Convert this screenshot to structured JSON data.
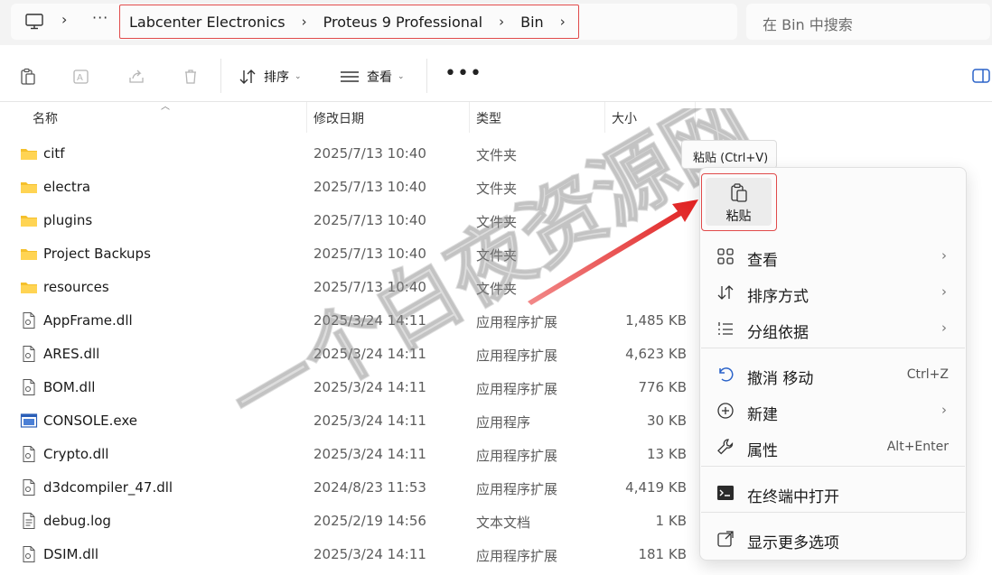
{
  "address": {
    "breadcrumbs": [
      "Labcenter Electronics",
      "Proteus 9 Professional",
      "Bin"
    ],
    "ellipsis": "···"
  },
  "search": {
    "placeholder": "在 Bin 中搜索"
  },
  "toolbar": {
    "sort_label": "排序",
    "view_label": "查看",
    "more_label": "•••"
  },
  "columns": {
    "name": "名称",
    "modified": "修改日期",
    "type": "类型",
    "size": "大小"
  },
  "files": [
    {
      "name": "citf",
      "modified": "2025/7/13 10:40",
      "type": "文件夹",
      "size": "",
      "icon": "folder-icon"
    },
    {
      "name": "electra",
      "modified": "2025/7/13 10:40",
      "type": "文件夹",
      "size": "",
      "icon": "folder-icon"
    },
    {
      "name": "plugins",
      "modified": "2025/7/13 10:40",
      "type": "文件夹",
      "size": "",
      "icon": "folder-icon"
    },
    {
      "name": "Project Backups",
      "modified": "2025/7/13 10:40",
      "type": "文件夹",
      "size": "",
      "icon": "folder-icon"
    },
    {
      "name": "resources",
      "modified": "2025/7/13 10:40",
      "type": "文件夹",
      "size": "",
      "icon": "folder-icon"
    },
    {
      "name": "AppFrame.dll",
      "modified": "2025/3/24 14:11",
      "type": "应用程序扩展",
      "size": "1,485 KB",
      "icon": "file-icon"
    },
    {
      "name": "ARES.dll",
      "modified": "2025/3/24 14:11",
      "type": "应用程序扩展",
      "size": "4,623 KB",
      "icon": "file-icon"
    },
    {
      "name": "BOM.dll",
      "modified": "2025/3/24 14:11",
      "type": "应用程序扩展",
      "size": "776 KB",
      "icon": "file-icon"
    },
    {
      "name": "CONSOLE.exe",
      "modified": "2025/3/24 14:11",
      "type": "应用程序",
      "size": "30 KB",
      "icon": "exe-icon"
    },
    {
      "name": "Crypto.dll",
      "modified": "2025/3/24 14:11",
      "type": "应用程序扩展",
      "size": "13 KB",
      "icon": "file-icon"
    },
    {
      "name": "d3dcompiler_47.dll",
      "modified": "2024/8/23 11:53",
      "type": "应用程序扩展",
      "size": "4,419 KB",
      "icon": "file-icon"
    },
    {
      "name": "debug.log",
      "modified": "2025/2/19 14:56",
      "type": "文本文档",
      "size": "1 KB",
      "icon": "text-file-icon"
    },
    {
      "name": "DSIM.dll",
      "modified": "2025/3/24 14:11",
      "type": "应用程序扩展",
      "size": "181 KB",
      "icon": "file-icon"
    }
  ],
  "context_menu": {
    "tooltip": "粘贴 (Ctrl+V)",
    "paste_label": "粘贴",
    "items": [
      {
        "label": "查看",
        "shortcut": "",
        "submenu": true,
        "icon": "grid-icon"
      },
      {
        "label": "排序方式",
        "shortcut": "",
        "submenu": true,
        "icon": "sort-icon"
      },
      {
        "label": "分组依据",
        "shortcut": "",
        "submenu": true,
        "icon": "group-list-icon"
      },
      {
        "label": "撤消 移动",
        "shortcut": "Ctrl+Z",
        "submenu": false,
        "icon": "undo-icon"
      },
      {
        "label": "新建",
        "shortcut": "",
        "submenu": true,
        "icon": "new-plus-icon"
      },
      {
        "label": "属性",
        "shortcut": "Alt+Enter",
        "submenu": false,
        "icon": "wrench-icon"
      },
      {
        "label": "在终端中打开",
        "shortcut": "",
        "submenu": false,
        "icon": "terminal-icon"
      },
      {
        "label": "显示更多选项",
        "shortcut": "",
        "submenu": false,
        "icon": "more-options-icon"
      }
    ]
  },
  "watermark": {
    "text": "一个白夜资源网"
  },
  "colors": {
    "highlight_border": "#e04a4a",
    "arrow": "#e03030",
    "folder": "#f5c02c"
  }
}
